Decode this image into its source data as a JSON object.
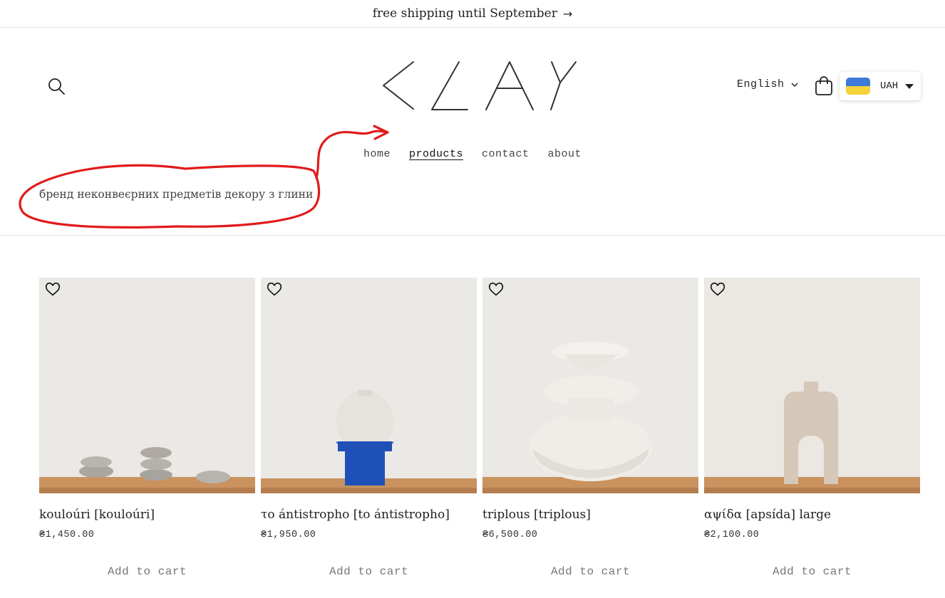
{
  "announcement": {
    "text": "free shipping until September",
    "arrow": "→"
  },
  "header": {
    "logo_text": "CLAY",
    "language": "English",
    "currency": "UAH"
  },
  "nav": [
    {
      "label": "home",
      "active": false
    },
    {
      "label": "products",
      "active": true
    },
    {
      "label": "contact",
      "active": false
    },
    {
      "label": "about",
      "active": false
    }
  ],
  "tagline": "бренд неконвеєрних предметів декору з глини",
  "products": [
    {
      "title": "kouloúri [kouloúri]",
      "price": "₴1,450.00",
      "add_label": "Add to cart"
    },
    {
      "title": "το ántistropho [to ántistropho]",
      "price": "₴1,950.00",
      "add_label": "Add to cart"
    },
    {
      "title": "triplous [triplous]",
      "price": "₴6,500.00",
      "add_label": "Add to cart"
    },
    {
      "title": "αψίδα [apsída] large",
      "price": "₴2,100.00",
      "add_label": "Add to cart"
    }
  ],
  "colors": {
    "annotation": "#e11b1b",
    "flag_blue": "#3d7ad9",
    "flag_yellow": "#f5d13a",
    "shelf": "#c9925f",
    "vase_blue": "#1f50b8"
  }
}
